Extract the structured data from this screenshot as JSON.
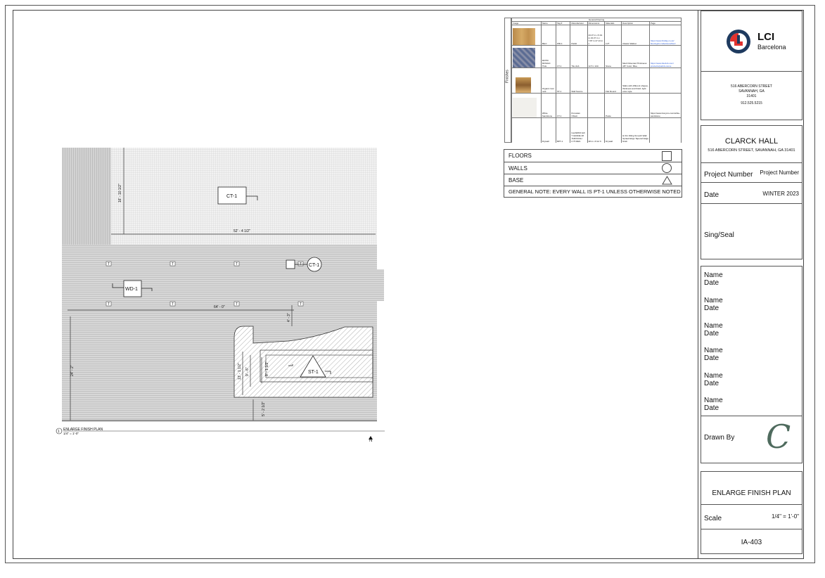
{
  "title_block": {
    "logo_top": "LCI",
    "logo_bottom": "Barcelona",
    "school_address": "516 ABERCORN STREET",
    "school_city": "SAVANNAH, GA",
    "school_zip": "31401",
    "school_phone": "912.525.5215",
    "project_name": "CLARCK HALL",
    "project_address": "516 ABERCORN STREET, SAVANNAH, GA 31401",
    "project_number_label": "Project Number",
    "project_number_value": "Project Number",
    "date_label": "Date",
    "date_value": "WINTER 2023",
    "seal_label": "Sing/Seal",
    "signoffs": [
      {
        "name": "Name",
        "date": "Date"
      },
      {
        "name": "Name",
        "date": "Date"
      },
      {
        "name": "Name",
        "date": "Date"
      },
      {
        "name": "Name",
        "date": "Date"
      },
      {
        "name": "Name",
        "date": "Date"
      },
      {
        "name": "Name",
        "date": "Date"
      }
    ],
    "drawn_by_label": "Drawn By",
    "drawn_by_initial": "C",
    "sheet_title": "ENLARGE FINISH PLAN",
    "scale_label": "Scale",
    "scale_value": "1/4\" = 1'-0\"",
    "sheet_number": "IA-403"
  },
  "legend": {
    "rows": [
      {
        "label": "FLOORS",
        "symbol": "square"
      },
      {
        "label": "WALLS",
        "symbol": "circle"
      },
      {
        "label": "BASE",
        "symbol": "triangle"
      }
    ],
    "note": "GENERAL NOTE: EVERY WALL IS PT-1 UNLESS OTHERWISE NOTED"
  },
  "finish_schedule": {
    "title": "General Flooring",
    "side_label": "Finishes",
    "headers": [
      "Image",
      "Name",
      "Tag #",
      "Manufacturer",
      "Dimensions",
      "Materials",
      "Description",
      "Page"
    ],
    "rows": [
      {
        "name": "Blurz",
        "tag": "WD-1",
        "mfr": "Parkit",
        "dims": "23.37 in x 5.91 in 23.37 in x 7.87 in 47.13 in x",
        "mat": "LVT",
        "desc": "Classic Walnut",
        "page": "https://www.findlay.co.uk/ flooring/lvt collections/blurz"
      },
      {
        "name": "MOTIF MOSAIC TILE",
        "tag": "CT-1",
        "mfr": "Tile club",
        "dims": "12.5 x 12in",
        "mat": "Stone",
        "desc": "Mesh Mounted Thickness: 3/8\" Color: Blue",
        "page": "https://www.tileclub.com/ products/patrick-stone"
      },
      {
        "name": "Organic river rock",
        "tag": "ST-1",
        "mfr": "Wall Source",
        "dims": "",
        "mat": "Flat Round",
        "desc": "Slabs with different shapes, thickness and finish; light color style",
        "page": ""
      },
      {
        "name": "White Sandstone",
        "tag": "CT-1",
        "mfr": "Porcelain Obtain",
        "dims": "",
        "mat": "Paste",
        "desc": "",
        "page": "https://www.bonyms.com/white-sandstone"
      },
      {
        "name": "Drywall",
        "tag": "BPT-1",
        "mfr": "GLASPRO EX T GRADE 48 THROUGH 2.75 RES",
        "dims": "48 in x 8.12 ft",
        "mat": "Drywall",
        "desc": "Hi Fin Filling Smooth Wall. Spraek Edge Tapered Edge finish",
        "page": ""
      }
    ]
  },
  "plan": {
    "dims": [
      "16' - 10 1/2\"",
      "52' - 4 1/2\"",
      "64' - 0\"",
      "4' - 3\"",
      "24' - 2\"",
      "13' - 1 1/2\"",
      "9' - 6\"",
      "8' - 1 1/2\"",
      "5' - 2 1/2\"",
      "3' - 9\""
    ],
    "tags": [
      "CT-1",
      "WD-1",
      "CT-1",
      "ST-1"
    ],
    "base_marker": "T",
    "caption_num": "1",
    "caption_title": "ENLARGE FINISH PLAN",
    "caption_scale": "1/4\" = 1'-0\"",
    "north": "N"
  },
  "colors": {
    "brand_red": "#e1322e",
    "brand_blue": "#1e3a5f"
  }
}
